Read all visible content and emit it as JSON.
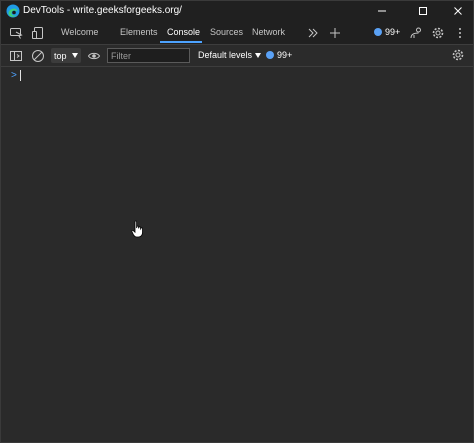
{
  "window": {
    "title": "DevTools - write.geeksforgeeks.org/",
    "logo_icon": "edge-logo-icon",
    "controls": [
      "minimize-icon",
      "maximize-icon",
      "close-icon"
    ]
  },
  "tabs": {
    "items": [
      {
        "label": "Welcome"
      },
      {
        "label": "Elements"
      },
      {
        "label": "Console",
        "active": true
      },
      {
        "label": "Sources"
      },
      {
        "label": "Network"
      }
    ],
    "issues_badge": "99+",
    "icons": [
      "inspect-element-icon",
      "device-emulation-icon",
      "more-tabs-icon",
      "add-tab-icon",
      "connection-icon",
      "settings-icon",
      "more-options-icon"
    ]
  },
  "toolbar": {
    "context": "top",
    "filter_placeholder": "Filter",
    "levels": "Default levels",
    "issues_badge": "99+",
    "icons": [
      "sidebar-toggle-icon",
      "clear-console-icon",
      "live-expression-icon",
      "settings-icon"
    ]
  },
  "console": {
    "prompt_symbol": ">"
  },
  "colors": {
    "accent": "#4da3ff",
    "background": "#2a2a2a",
    "titlebar": "#202020"
  }
}
